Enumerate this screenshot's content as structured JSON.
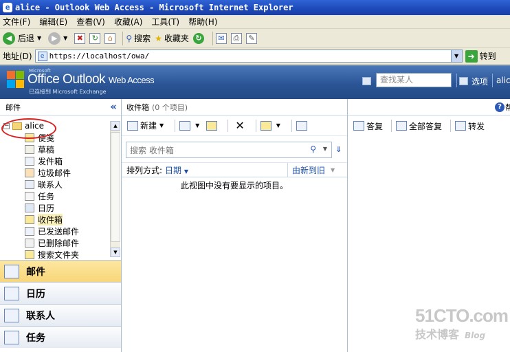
{
  "browser": {
    "title": "alice - Outlook Web Access - Microsoft Internet Explorer",
    "menu": [
      "文件(F)",
      "编辑(E)",
      "查看(V)",
      "收藏(A)",
      "工具(T)",
      "帮助(H)"
    ],
    "toolbar": {
      "back": "后退",
      "search": "搜索",
      "favorites": "收藏夹"
    },
    "address_label": "地址(D)",
    "url": "https://localhost/owa/",
    "go": "转到"
  },
  "owa": {
    "brand_small": "Microsoft",
    "brand_main": "Office Outlook",
    "brand_wa": "Web Access",
    "brand_sub": "已连接到 Microsoft Exchange",
    "find_person_placeholder": "查找某人",
    "options": "选项",
    "user": "alice"
  },
  "left_pane": {
    "header": "邮件",
    "root": "alice",
    "folders": [
      {
        "label": "便笺",
        "icon": "note-icon"
      },
      {
        "label": "草稿",
        "icon": "drafts-icon"
      },
      {
        "label": "发件箱",
        "icon": "outbox-icon"
      },
      {
        "label": "垃圾邮件",
        "icon": "junk-mail-icon"
      },
      {
        "label": "联系人",
        "icon": "contacts-icon"
      },
      {
        "label": "任务",
        "icon": "tasks-icon"
      },
      {
        "label": "日历",
        "icon": "calendar-icon"
      },
      {
        "label": "收件箱",
        "icon": "inbox-icon",
        "selected": true
      },
      {
        "label": "已发送邮件",
        "icon": "sent-items-icon"
      },
      {
        "label": "已删除邮件",
        "icon": "deleted-items-icon"
      },
      {
        "label": "搜索文件夹",
        "icon": "search-folder-icon"
      }
    ],
    "nav": [
      {
        "label": "邮件",
        "icon": "mail-icon",
        "active": true
      },
      {
        "label": "日历",
        "icon": "calendar-icon"
      },
      {
        "label": "联系人",
        "icon": "contacts-icon"
      },
      {
        "label": "任务",
        "icon": "tasks-icon"
      }
    ]
  },
  "mid_pane": {
    "folder_title": "收件箱",
    "count": "(0 个项目)",
    "new_label": "新建",
    "search_placeholder": "搜索 收件箱",
    "sort_label": "排列方式:",
    "sort_field": "日期",
    "sort_order": "由新到旧",
    "empty_message": "此视图中没有要显示的项目。"
  },
  "right_pane": {
    "help_tail": "帮",
    "reply": "答复",
    "reply_all": "全部答复",
    "forward": "转发"
  },
  "watermark": {
    "big": "51CTO.com",
    "small": "技术博客",
    "blog": "Blog"
  }
}
